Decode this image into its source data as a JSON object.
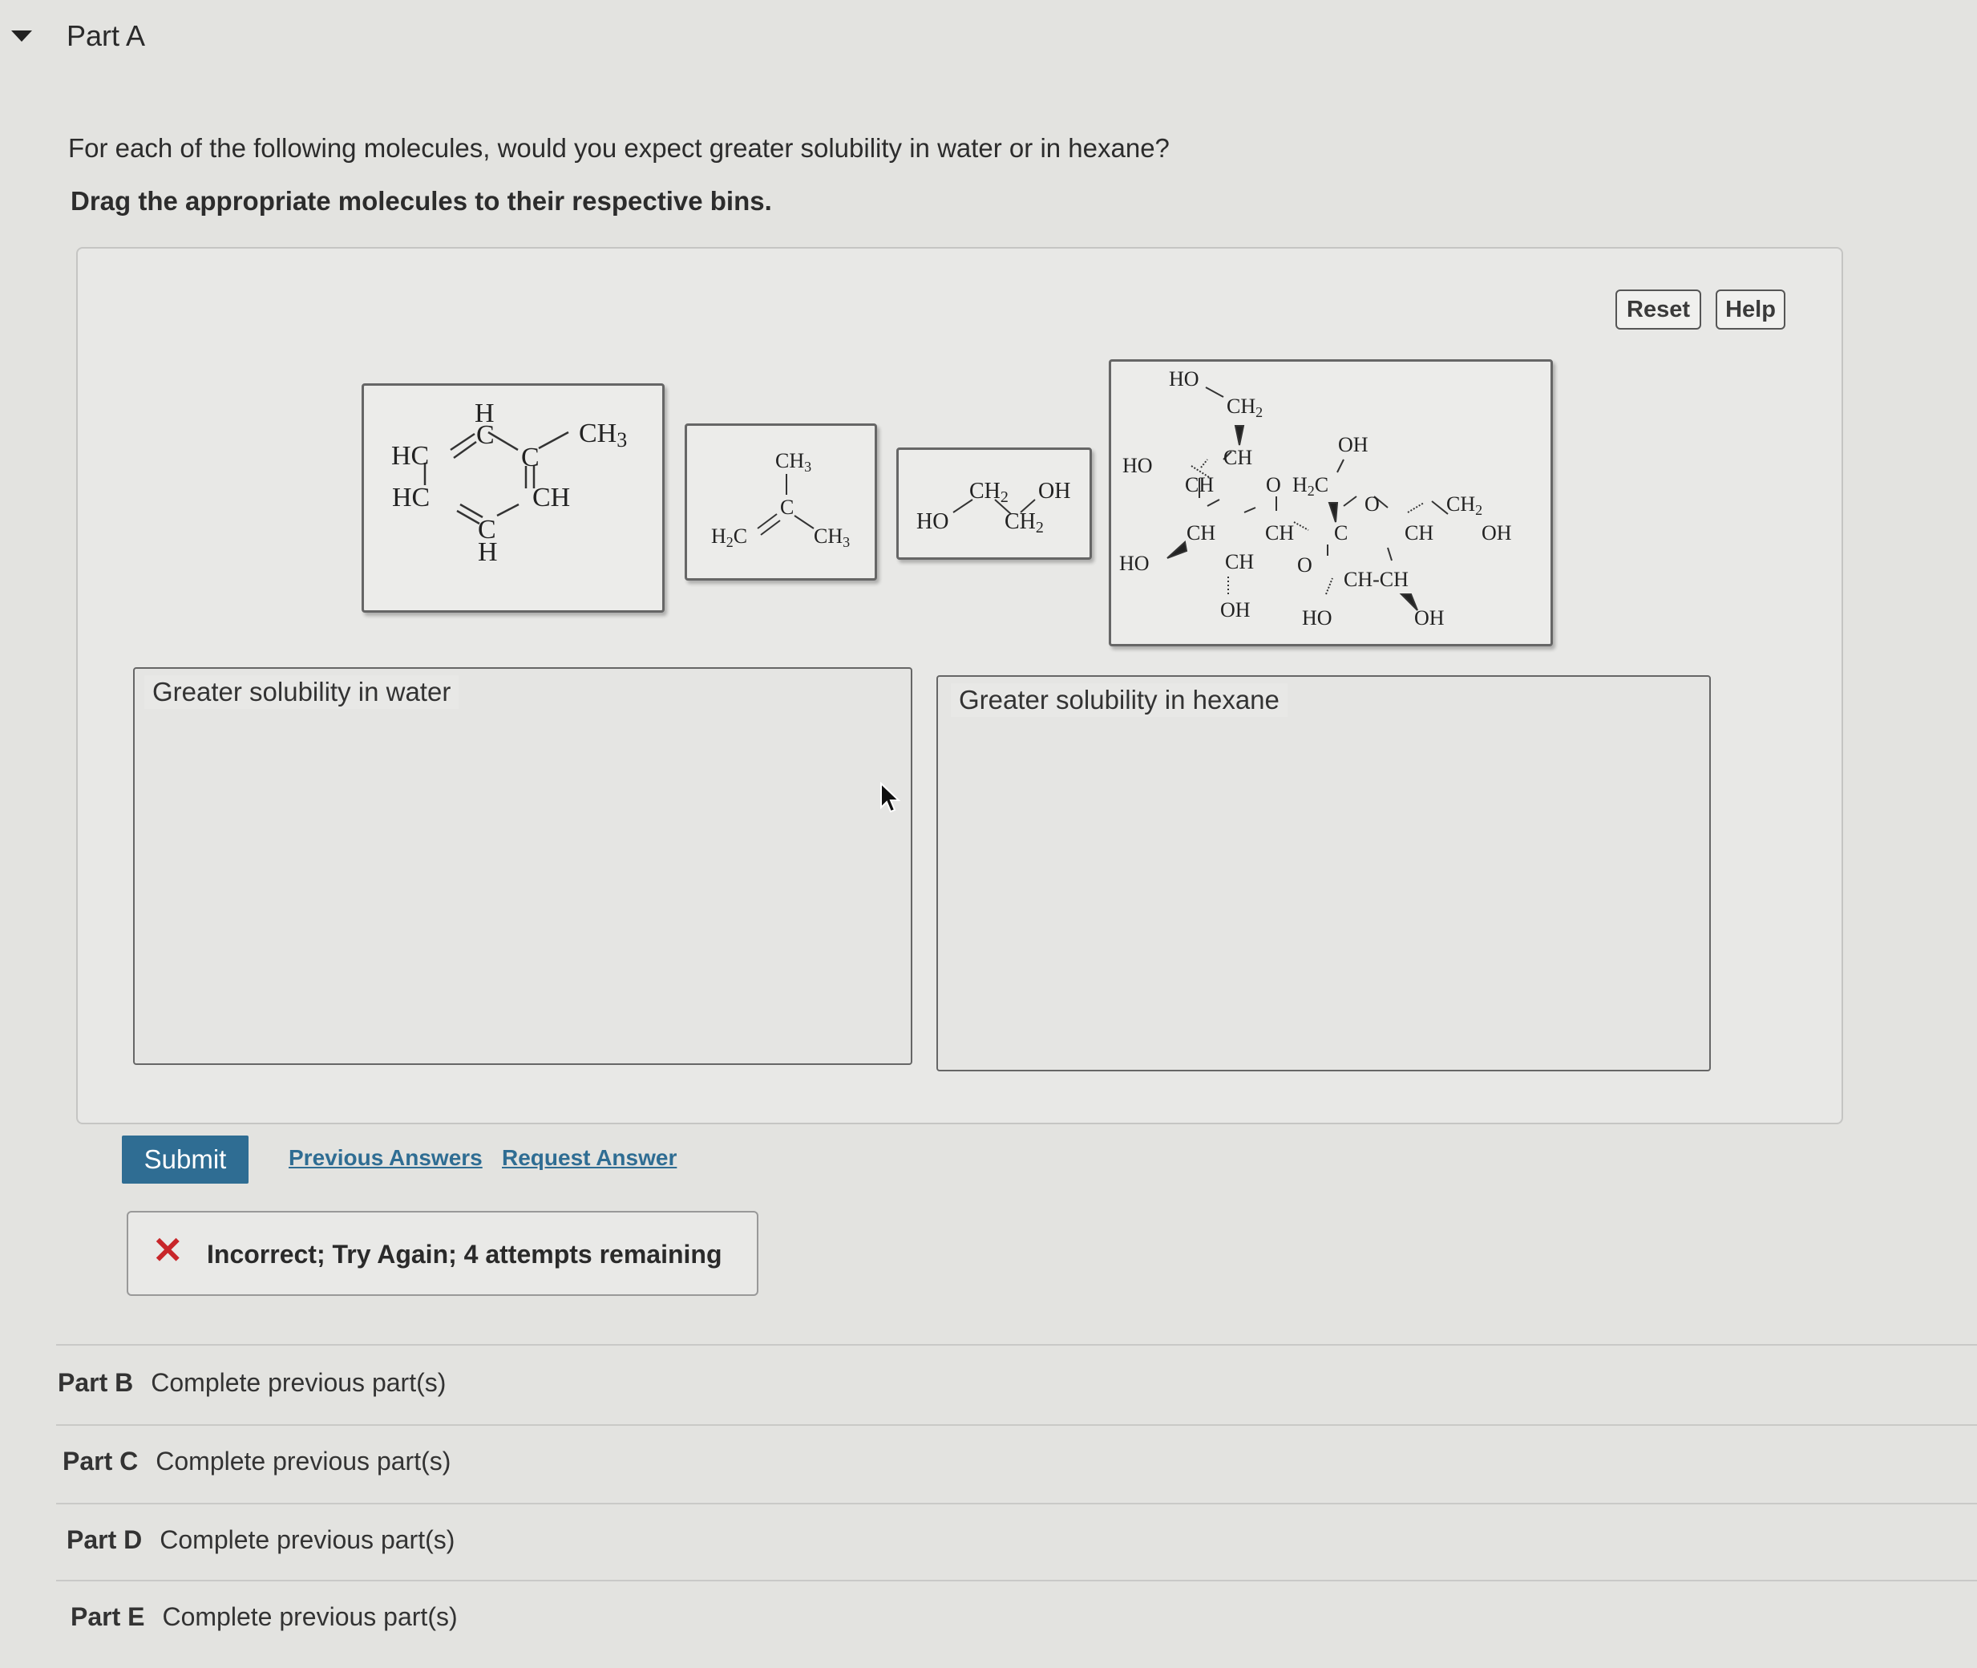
{
  "part_a": {
    "title": "Part A",
    "question": "For each of the following molecules, would you expect greater solubility in water or in hexane?",
    "instruction": "Drag the appropriate molecules to their respective bins."
  },
  "toolbar": {
    "reset_label": "Reset",
    "help_label": "Help"
  },
  "molecules": {
    "toluene": {
      "HC_top": "HC",
      "HC_bot": "HC",
      "H_top": "H",
      "C_top": "C",
      "C_right": "C",
      "CH3": "CH",
      "CH3_sub": "3",
      "CH_right": "CH",
      "C_bot": "C",
      "H_bot": "H"
    },
    "isobutylene": {
      "CH3_top": "CH",
      "sub3a": "3",
      "C": "C",
      "H2C": "H",
      "sub2": "2",
      "H2C_C": "C",
      "CH3_right": "CH",
      "sub3b": "3"
    },
    "glycol": {
      "HO": "HO",
      "CH2a": "CH",
      "sub2a": "2",
      "OH": "OH",
      "CH2b": "CH",
      "sub2b": "2"
    },
    "sucrose": {
      "t1": "HO",
      "t2": "CH",
      "t2s": "2",
      "t3": "CH",
      "t4": "OH",
      "t5": "HO",
      "t6": "CH",
      "t7": "O",
      "t8": "H",
      "t8s": "2",
      "t8c": "C",
      "t9": "O",
      "t10": "CH",
      "t10s": "2",
      "t11": "CH",
      "t12": "CH",
      "t13": "C",
      "t14": "CH",
      "t15": "OH",
      "t16": "HO",
      "t17": "CH",
      "t18": "O",
      "t19": "CH-CH",
      "t20": "OH",
      "t21": "HO",
      "t22": "OH"
    }
  },
  "bins": {
    "water_label": "Greater solubility in water",
    "hexane_label": "Greater solubility in hexane"
  },
  "actions": {
    "submit_label": "Submit",
    "previous_answers_label": "Previous Answers",
    "request_answer_label": "Request Answer"
  },
  "feedback": {
    "icon": "x-icon",
    "message": "Incorrect; Try Again; 4 attempts remaining",
    "color": "#c8262a"
  },
  "parts": [
    {
      "name": "Part B",
      "status": "Complete previous part(s)"
    },
    {
      "name": "Part C",
      "status": "Complete previous part(s)"
    },
    {
      "name": "Part D",
      "status": "Complete previous part(s)"
    },
    {
      "name": "Part E",
      "status": "Complete previous part(s)"
    }
  ]
}
